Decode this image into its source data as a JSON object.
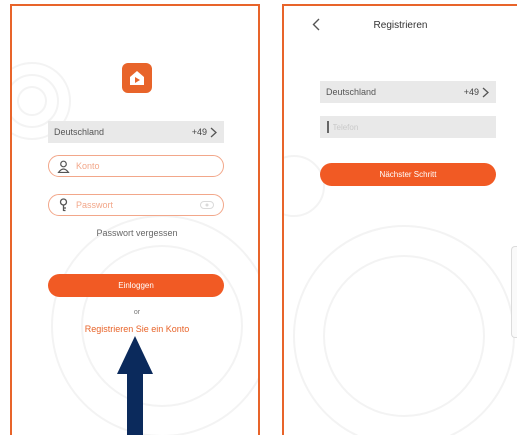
{
  "login": {
    "logo_icon": "home-play-icon",
    "country": {
      "name": "Deutschland",
      "code": "+49"
    },
    "account_placeholder": "Konto",
    "password_placeholder": "Passwort",
    "forgot_password": "Passwort vergessen",
    "login_button": "Einloggen",
    "or_text": "or",
    "register_link": "Registrieren Sie ein Konto"
  },
  "register": {
    "title": "Registrieren",
    "country": {
      "name": "Deutschland",
      "code": "+49"
    },
    "phone_placeholder": "Telefon",
    "next_button": "Nächster Schritt"
  },
  "annotation": {
    "arrow_icon": "arrow-up-icon",
    "color": "#0b2a5c"
  },
  "colors": {
    "accent": "#f15a24",
    "border": "#e8642a",
    "field_outline": "#f2a78a",
    "field_bg": "#e9e9e9"
  }
}
